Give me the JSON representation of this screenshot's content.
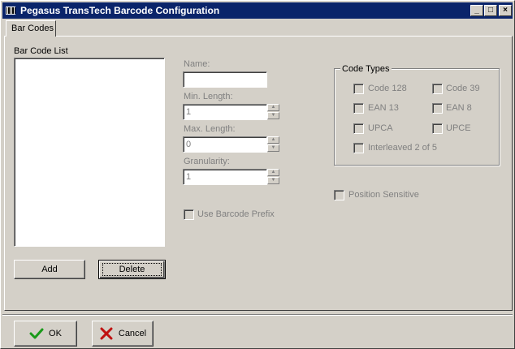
{
  "window": {
    "title": "Pegasus TransTech Barcode Configuration",
    "minimize_symbol": "_",
    "maximize_symbol": "□",
    "close_symbol": "×"
  },
  "tabs": [
    {
      "label": "Bar Codes",
      "selected": true
    }
  ],
  "barcode_list": {
    "label": "Bar Code List",
    "items": []
  },
  "buttons": {
    "add": "Add",
    "delete": "Delete",
    "ok": "OK",
    "cancel": "Cancel"
  },
  "fields": {
    "name": {
      "label": "Name:",
      "value": ""
    },
    "min_length": {
      "label": "Min. Length:",
      "value": "1"
    },
    "max_length": {
      "label": "Max. Length:",
      "value": "0"
    },
    "granularity": {
      "label": "Granularity:",
      "value": "1"
    },
    "spin_up": "▲",
    "spin_down": "▼"
  },
  "use_barcode_prefix": {
    "label": "Use Barcode Prefix",
    "checked": false
  },
  "code_types": {
    "title": "Code Types",
    "code128": "Code 128",
    "code39": "Code 39",
    "ean13": "EAN 13",
    "ean8": "EAN 8",
    "upca": "UPCA",
    "upce": "UPCE",
    "interleaved": "Interleaved 2 of 5"
  },
  "position_sensitive": {
    "label": "Position Sensitive",
    "checked": false
  },
  "icons": {
    "ok": "check-icon",
    "cancel": "x-icon",
    "app": "barcode-app-icon"
  },
  "colors": {
    "titlebar": "#0a246a",
    "dialog": "#d4d0c8",
    "ok_check": "#1a9a1a",
    "cancel_x": "#c01010"
  }
}
